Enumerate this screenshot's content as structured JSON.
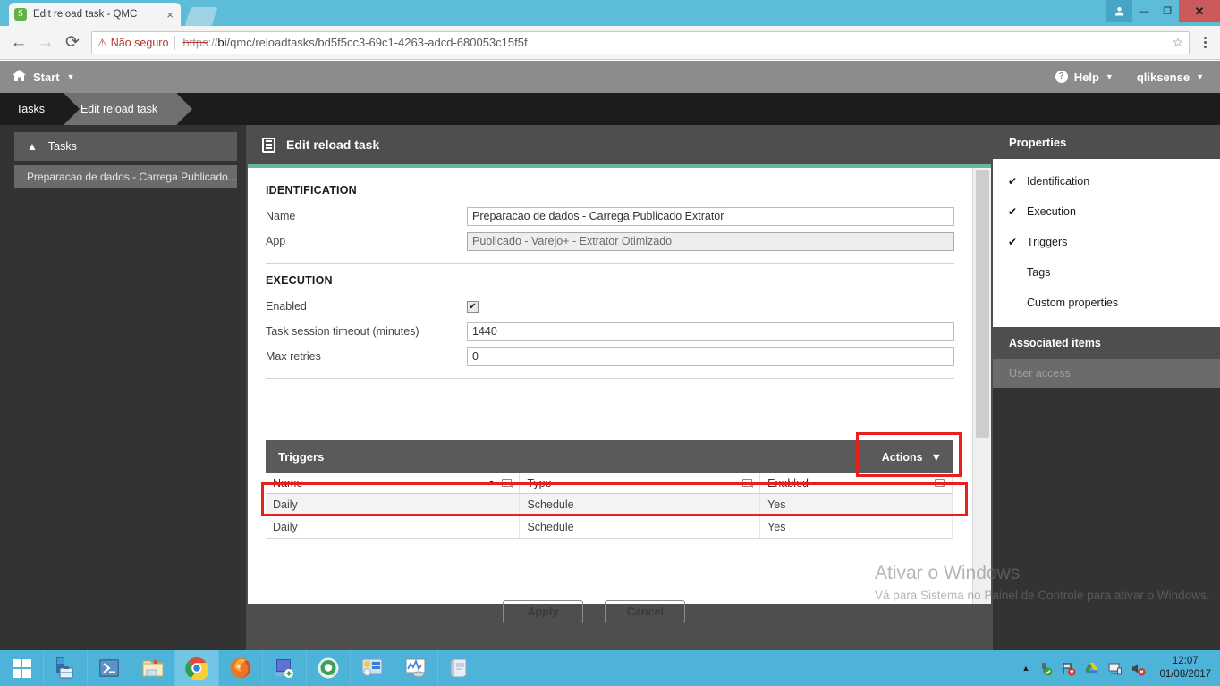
{
  "browser": {
    "tab": {
      "favicon": "qlik-sense-favicon",
      "favicon_letter": "S",
      "title": "Edit reload task - QMC",
      "close_label": "×"
    },
    "newtab_label": "+",
    "window_controls": {
      "avatar": "●",
      "minimize": "—",
      "restore": "❐",
      "close": "✕"
    },
    "toolbar": {
      "back": "←",
      "forward": "→",
      "reload": "⟳",
      "warn_icon": "⚠",
      "warn_text": "Não seguro",
      "url_scheme": "https",
      "url_sep": "://",
      "url_host": "bi",
      "url_path": "/qmc/reloadtasks/bd5f5cc3-69c1-4263-adcd-680053c15f5f",
      "star": "☆"
    }
  },
  "topbar": {
    "start_label": "Start",
    "start_caret": "▼",
    "help_label": "Help",
    "help_icon_char": "?",
    "help_caret": "▼",
    "user_label": "qliksense",
    "user_caret": "▼"
  },
  "breadcrumb": {
    "items": [
      {
        "label": "Tasks",
        "active": false
      },
      {
        "label": "Edit reload task",
        "active": true
      }
    ]
  },
  "sidebar": {
    "header": {
      "label": "Tasks",
      "chevron": "▲"
    },
    "items": [
      {
        "label": "Preparacao de dados - Carrega Publicado..."
      }
    ]
  },
  "main": {
    "header_title": "Edit reload task",
    "identification": {
      "section_label": "IDENTIFICATION",
      "fields": [
        {
          "label": "Name",
          "value": "Preparacao de dados - Carrega Publicado Extrator",
          "readonly": false
        },
        {
          "label": "App",
          "value": "Publicado - Varejo+ - Extrator Otimizado",
          "readonly": true
        }
      ]
    },
    "execution": {
      "section_label": "EXECUTION",
      "enabled_label": "Enabled",
      "enabled_checked": "✔",
      "fields": [
        {
          "label": "Task session timeout (minutes)",
          "value": "1440"
        },
        {
          "label": "Max retries",
          "value": "0"
        }
      ]
    },
    "triggers": {
      "title": "Triggers",
      "actions_label": "Actions",
      "actions_caret": "▼",
      "columns": [
        {
          "label": "Name",
          "sorted": true,
          "sort_caret": "▼"
        },
        {
          "label": "Type",
          "sorted": false
        },
        {
          "label": "Enabled",
          "sorted": false
        }
      ],
      "rows": [
        {
          "name": "Daily",
          "type": "Schedule",
          "enabled": "Yes"
        },
        {
          "name": "Daily",
          "type": "Schedule",
          "enabled": "Yes"
        }
      ]
    },
    "footer": {
      "apply_label": "Apply",
      "cancel_label": "Cancel"
    }
  },
  "properties": {
    "title": "Properties",
    "items": [
      {
        "label": "Identification",
        "checked": true,
        "check": "✔"
      },
      {
        "label": "Execution",
        "checked": true,
        "check": "✔"
      },
      {
        "label": "Triggers",
        "checked": true,
        "check": "✔"
      },
      {
        "label": "Tags",
        "checked": false,
        "check": ""
      },
      {
        "label": "Custom properties",
        "checked": false,
        "check": ""
      }
    ],
    "associated_title": "Associated items",
    "associated_items": [
      {
        "label": "User access"
      }
    ]
  },
  "watermark": {
    "title": "Ativar o Windows",
    "subtitle": "Vá para Sistema no Painel de Controle para ativar o Windows."
  },
  "taskbar": {
    "start": "windows-start-icon",
    "items": [
      {
        "name": "tools-icon",
        "active": false
      },
      {
        "name": "powershell-icon",
        "active": false
      },
      {
        "name": "file-explorer-icon",
        "active": false
      },
      {
        "name": "chrome-icon",
        "active": true
      },
      {
        "name": "firefox-icon",
        "active": false
      },
      {
        "name": "sql-server-management-studio-icon",
        "active": false
      },
      {
        "name": "qlik-sense-icon",
        "active": false
      },
      {
        "name": "control-panel-icon",
        "active": false
      },
      {
        "name": "performance-monitor-icon",
        "active": false
      },
      {
        "name": "notepad-icon",
        "active": false
      }
    ],
    "tray": {
      "expand_caret": "▲",
      "icons": [
        "usb-safely-remove-icon",
        "action-center-flag-icon",
        "google-drive-icon",
        "network-icon",
        "volume-muted-icon"
      ],
      "time": "12:07",
      "date": "01/08/2017"
    }
  },
  "colors": {
    "accent_teal": "#6ab5a0",
    "highlight_red": "#e8201c",
    "taskbar_blue": "#4eb3d9",
    "qmc_gray": "#5a5a5a"
  }
}
